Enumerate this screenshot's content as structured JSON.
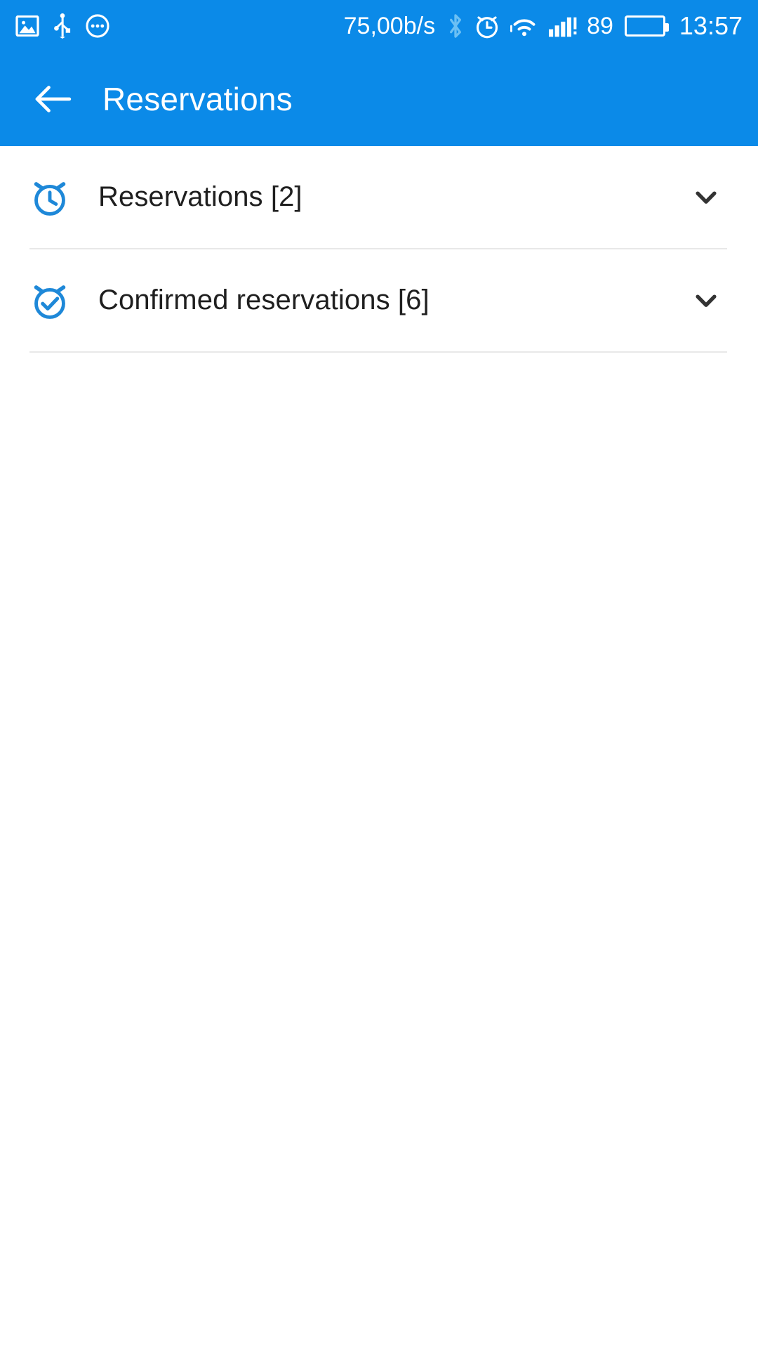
{
  "theme": {
    "primary_color": "#0b8ae8",
    "icon_accent_color": "#1e88d8",
    "battery_color": "#14dd14",
    "text_color": "#1f1f1f",
    "divider_color": "#e8e8e8"
  },
  "status_bar": {
    "left_icons": [
      {
        "name": "image-icon"
      },
      {
        "name": "usb-icon"
      },
      {
        "name": "more-circle-icon"
      }
    ],
    "network_speed": "75,00b/s",
    "right_icons": [
      {
        "name": "bluetooth-icon"
      },
      {
        "name": "alarm-icon"
      },
      {
        "name": "wifi-icon"
      },
      {
        "name": "signal-bars-icon"
      }
    ],
    "battery_percent": "89",
    "clock": "13:57"
  },
  "app_bar": {
    "back_label": "back-arrow",
    "title": "Reservations"
  },
  "list": {
    "rows": [
      {
        "icon": "alarm-clock-icon",
        "label": "Reservations [2]",
        "chevron": "chevron-down-icon",
        "expanded": false
      },
      {
        "icon": "alarm-clock-check-icon",
        "label": "Confirmed reservations [6]",
        "chevron": "chevron-down-icon",
        "expanded": false
      }
    ]
  }
}
